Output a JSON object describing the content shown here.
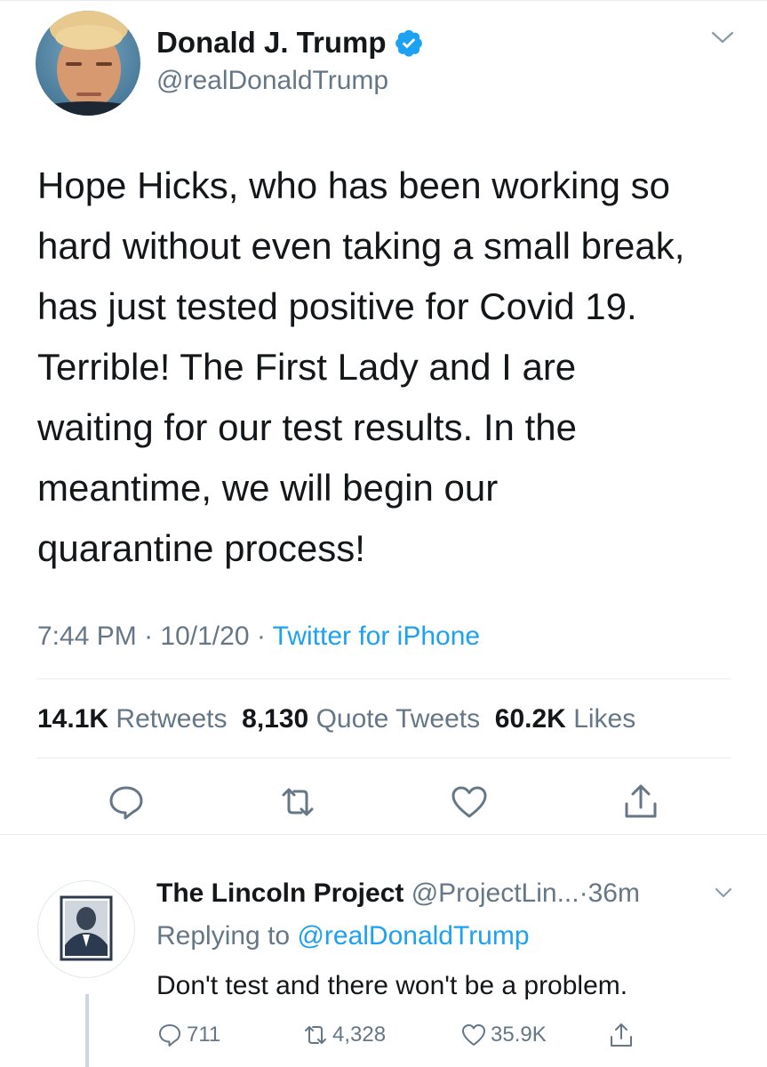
{
  "tweet": {
    "author_name": "Donald J. Trump",
    "author_handle": "@realDonaldTrump",
    "lines": [
      "Hope Hicks, who has been working so",
      "hard without even taking a small break,",
      "has just tested positive for Covid 19.",
      "Terrible! The First Lady and I are",
      "waiting for our test results. In the",
      "meantime, we will begin our",
      "quarantine process!"
    ],
    "time": "7:44 PM",
    "date": "10/1/20",
    "dot": "·",
    "source": "Twitter for iPhone",
    "stats": {
      "retweets_count": "14.1K",
      "retweets_label": "Retweets",
      "quotes_count": "8,130",
      "quotes_label": "Quote Tweets",
      "likes_count": "60.2K",
      "likes_label": "Likes"
    }
  },
  "reply": {
    "author_name": "The Lincoln Project",
    "author_handle": "@ProjectLin...",
    "dot": "·",
    "age": "36m",
    "replying_prefix": "Replying to",
    "replying_handle": "@realDonaldTrump",
    "text": "Don't test and there won't be a problem.",
    "reply_count": "711",
    "retweet_count": "4,328",
    "like_count": "35.9K"
  },
  "colors": {
    "accent": "#1da1f2",
    "muted": "#657786",
    "text": "#14171a",
    "divider": "#e6ecf0"
  },
  "icons": [
    "verified-badge-icon",
    "chevron-down-icon",
    "reply-icon",
    "retweet-icon",
    "like-icon",
    "share-icon"
  ]
}
